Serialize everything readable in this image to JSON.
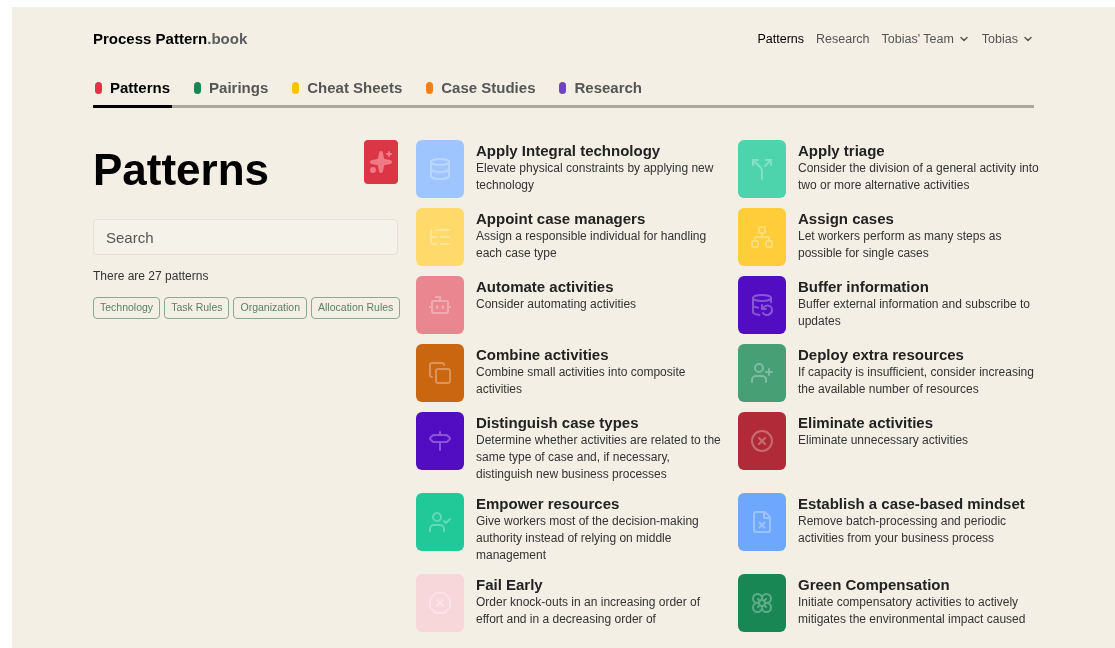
{
  "brand": {
    "name": "Process Pattern",
    "suffix": ".book"
  },
  "top_nav": [
    {
      "label": "Patterns",
      "selected": true,
      "dropdown": false
    },
    {
      "label": "Research",
      "selected": false,
      "dropdown": false
    },
    {
      "label": "Tobias' Team",
      "selected": false,
      "dropdown": true
    },
    {
      "label": "Tobias",
      "selected": false,
      "dropdown": true
    }
  ],
  "tabs": [
    {
      "label": "Patterns",
      "selected": true,
      "color": "#dc3545"
    },
    {
      "label": "Pairings",
      "selected": false,
      "color": "#198754"
    },
    {
      "label": "Cheat Sheets",
      "selected": false,
      "color": "#ffc107"
    },
    {
      "label": "Case Studies",
      "selected": false,
      "color": "#fd7e14"
    },
    {
      "label": "Research",
      "selected": false,
      "color": "#6f42c1"
    }
  ],
  "sidebar": {
    "title": "Patterns",
    "search": {
      "placeholder": "Search"
    },
    "count": "There are 27 patterns",
    "tags": [
      "Technology",
      "Task Rules",
      "Organization",
      "Allocation Rules"
    ]
  },
  "patterns": [
    {
      "title": "Apply Integral technology",
      "description": "Elevate physical constraints by applying new technology",
      "color": "#9ec5fe"
    },
    {
      "title": "Apply triage",
      "description": "Consider the division of a general activity into two or more alternative activities",
      "color": "#4dd4ac"
    },
    {
      "title": "Appoint case managers",
      "description": "Assign a responsible individual for handling each case type",
      "color": "#ffda6a"
    },
    {
      "title": "Assign cases",
      "description": "Let workers perform as many steps as possible for single cases",
      "color": "#ffcd39"
    },
    {
      "title": "Automate activities",
      "description": "Consider automating activities",
      "color": "#ea868f"
    },
    {
      "title": "Buffer information",
      "description": "Buffer external information and subscribe to updates",
      "color": "#520dc2"
    },
    {
      "title": "Combine activities",
      "description": "Combine small activities into composite activities",
      "color": "#ca6510"
    },
    {
      "title": "Deploy extra resources",
      "description": "If capacity is insufficient, consider increasing the available number of resources",
      "color": "#479f76"
    },
    {
      "title": "Distinguish case types",
      "description": "Determine whether activities are related to the same type of case and, if necessary, distinguish new business processes",
      "color": "#520dc2"
    },
    {
      "title": "Eliminate activities",
      "description": "Eliminate unnecessary activities",
      "color": "#b02a37"
    },
    {
      "title": "Empower resources",
      "description": "Give workers most of the decision-making authority instead of relying on middle management",
      "color": "#20c997"
    },
    {
      "title": "Establish a case-based mindset",
      "description": "Remove batch-processing and periodic activities from your business process",
      "color": "#6ea8fe"
    },
    {
      "title": "Fail Early",
      "description": "Order knock-outs in an increasing order of effort and in a decreasing order of",
      "color": "#f8d7da"
    },
    {
      "title": "Green Compensation",
      "description": "Initiate compensatory activities to actively mitigates the environmental impact caused",
      "color": "#198754"
    }
  ]
}
